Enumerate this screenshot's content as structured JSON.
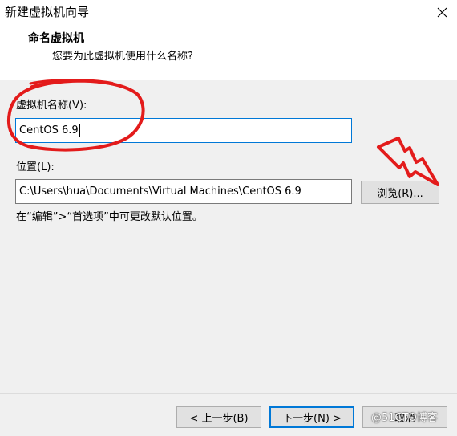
{
  "window": {
    "title": "新建虚拟机向导",
    "close_symbol": "✕"
  },
  "header": {
    "title": "命名虚拟机",
    "subtitle": "您要为此虚拟机使用什么名称?"
  },
  "form": {
    "name_label": "虚拟机名称(V):",
    "name_value": "CentOS 6.9",
    "location_label": "位置(L):",
    "location_value": "C:\\Users\\hua\\Documents\\Virtual Machines\\CentOS 6.9",
    "browse_label": "浏览(R)...",
    "hint": "在“编辑”>“首选项”中可更改默认位置。"
  },
  "footer": {
    "back_label": "< 上一步(B)",
    "next_label": "下一步(N) >",
    "cancel_label": "取消"
  },
  "watermark": {
    "text": "@51CTO博客"
  },
  "colors": {
    "annotation": "#e31b1b",
    "focus": "#0078d7"
  },
  "icons": {
    "close": "close-icon",
    "annotation_arrow": "lightning-arrow-icon"
  }
}
